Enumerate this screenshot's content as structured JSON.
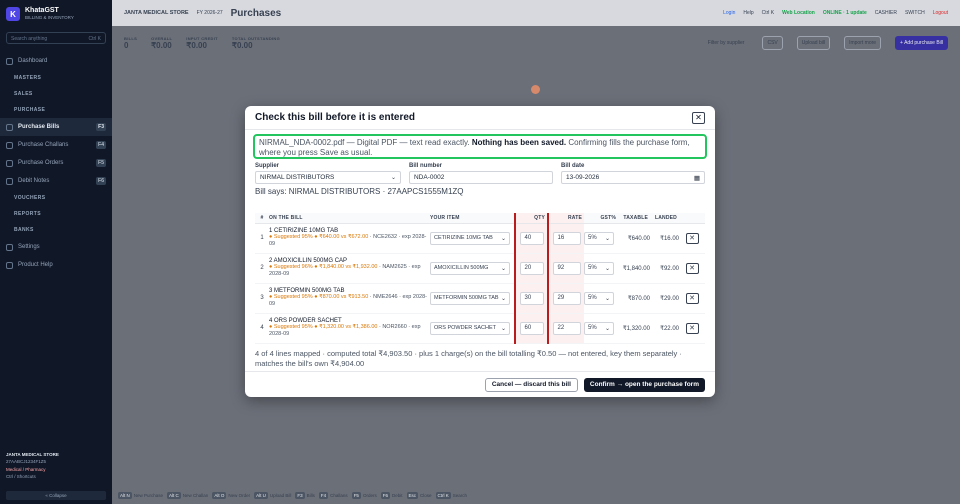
{
  "sidebar": {
    "logo_letter": "K",
    "brand_name": "KhataGST",
    "brand_sub": "BILLING & INVENTORY",
    "search_placeholder": "Search anything",
    "search_shortcut": "Ctrl K",
    "items": [
      {
        "label": "Dashboard",
        "type": "item"
      },
      {
        "label": "MASTERS",
        "type": "section"
      },
      {
        "label": "SALES",
        "type": "section"
      },
      {
        "label": "PURCHASE",
        "type": "section"
      },
      {
        "label": "Purchase Bills",
        "type": "active",
        "badge": "F3"
      },
      {
        "label": "Purchase Challans",
        "type": "item",
        "badge": "F4"
      },
      {
        "label": "Purchase Orders",
        "type": "item",
        "badge": "F5"
      },
      {
        "label": "Debit Notes",
        "type": "item",
        "badge": "F6"
      },
      {
        "label": "VOUCHERS",
        "type": "section"
      },
      {
        "label": "REPORTS",
        "type": "section"
      },
      {
        "label": "BANKS",
        "type": "section"
      },
      {
        "label": "Settings",
        "type": "item"
      },
      {
        "label": "Product Help",
        "type": "item"
      }
    ],
    "footer_store": "JANTA MEDICAL STORE",
    "footer_gstin": "27AABCJ1234F1Z5",
    "footer_type": "Medical / Pharmacy",
    "footer_shortcuts": "Ctrl / Shortcuts",
    "collapse_label": "« Collapse"
  },
  "topbar": {
    "store": "JANTA MEDICAL STORE",
    "fy": "FY 2026-27",
    "page_title": "Purchases",
    "links": [
      "Login",
      "Help",
      "Ctrl K"
    ],
    "status": "Web Location",
    "sync": "ONLINE · 1 update",
    "user": "CASHIER",
    "switch": "SWITCH",
    "logout": "Logout"
  },
  "stats": [
    {
      "label": "BILLS",
      "value": "0"
    },
    {
      "label": "OVERALL",
      "value": "₹0.00"
    },
    {
      "label": "INPUT CREDIT",
      "value": "₹0.00"
    },
    {
      "label": "TOTAL OUTSTANDING",
      "value": "₹0.00"
    }
  ],
  "toolbar": {
    "filter": "Filter by supplier",
    "csv": "CSV",
    "upload": "Upload bill",
    "import": "Import more",
    "add": "+ Add purchase Bill"
  },
  "bottombar": [
    {
      "key": "Alt N",
      "label": "New Purchase"
    },
    {
      "key": "Alt C",
      "label": "New Challan"
    },
    {
      "key": "Alt O",
      "label": "New Order"
    },
    {
      "key": "Alt U",
      "label": "Upload Bill"
    },
    {
      "key": "F3",
      "label": "Bills"
    },
    {
      "key": "F4",
      "label": "Challans"
    },
    {
      "key": "F5",
      "label": "Orders"
    },
    {
      "key": "F6",
      "label": "Debit"
    },
    {
      "key": "Esc",
      "label": "Close"
    },
    {
      "key": "Ctrl K",
      "label": "Search"
    }
  ],
  "modal": {
    "title": "Check this bill before it is entered",
    "notice_file": "NIRMAL_NDA-0002.pdf — Digital PDF — text read exactly.",
    "notice_bold": "Nothing has been saved.",
    "notice_rest": "Confirming fills the purchase form, where you press Save as usual.",
    "supplier_label": "Supplier",
    "supplier_value": "NIRMAL DISTRIBUTORS",
    "bill_number_label": "Bill number",
    "bill_number_value": "NDA-0002",
    "bill_date_label": "Bill date",
    "bill_date_value": "13-09-2026",
    "bill_says": "Bill says: NIRMAL DISTRIBUTORS · 27AAPCS1555M1ZQ",
    "columns": [
      "#",
      "ON THE BILL",
      "YOUR ITEM",
      "QTY",
      "RATE",
      "GST%",
      "TAXABLE",
      "LANDED"
    ],
    "rows": [
      {
        "n": "1",
        "bill_item": "1 CETIRIZINE 10MG TAB",
        "suggest": "● Suggested 95% ● ₹640.00 vs ₹672.00",
        "rest": " · NCE2632 · exp 2028-09",
        "your_item": "CETIRIZINE 10MG TAB",
        "qty": "40",
        "rate": "16",
        "gst": "5%",
        "taxable": "₹640.00",
        "landed": "₹16.00"
      },
      {
        "n": "2",
        "bill_item": "2 AMOXICILLIN 500MG CAP",
        "suggest": "● Suggested 96% ● ₹1,840.00 vs ₹1,932.00",
        "rest": " · NAM2625 · exp 2028-09",
        "your_item": "AMOXICILLIN 500MG",
        "qty": "20",
        "rate": "92",
        "gst": "5%",
        "taxable": "₹1,840.00",
        "landed": "₹92.00"
      },
      {
        "n": "3",
        "bill_item": "3 METFORMIN 500MG TAB",
        "suggest": "● Suggested 95% ● ₹870.00 vs ₹913.50",
        "rest": " · NME2646 · exp 2028-09",
        "your_item": "METFORMIN 500MG TAB",
        "qty": "30",
        "rate": "29",
        "gst": "5%",
        "taxable": "₹870.00",
        "landed": "₹29.00"
      },
      {
        "n": "4",
        "bill_item": "4 ORS POWDER SACHET",
        "suggest": "● Suggested 95% ● ₹1,320.00 vs ₹1,386.00",
        "rest": " · NOR2660 · exp 2028-09",
        "your_item": "ORS POWDER SACHET",
        "qty": "60",
        "rate": "22",
        "gst": "5%",
        "taxable": "₹1,320.00",
        "landed": "₹22.00"
      }
    ],
    "summary": "4 of 4 lines mapped · computed total ₹4,903.50 · plus 1 charge(s) on the bill totalling ₹0.50 — not entered, key them separately · matches the bill's own ₹4,904.00",
    "cancel_label": "Cancel — discard this bill",
    "confirm_label": "Confirm → open the purchase form"
  },
  "colors": {
    "notice_border": "#22c55e",
    "qty_rate_border": "#b91c1c",
    "confirm_bg": "#111827",
    "sidebar_bg": "#101828"
  }
}
